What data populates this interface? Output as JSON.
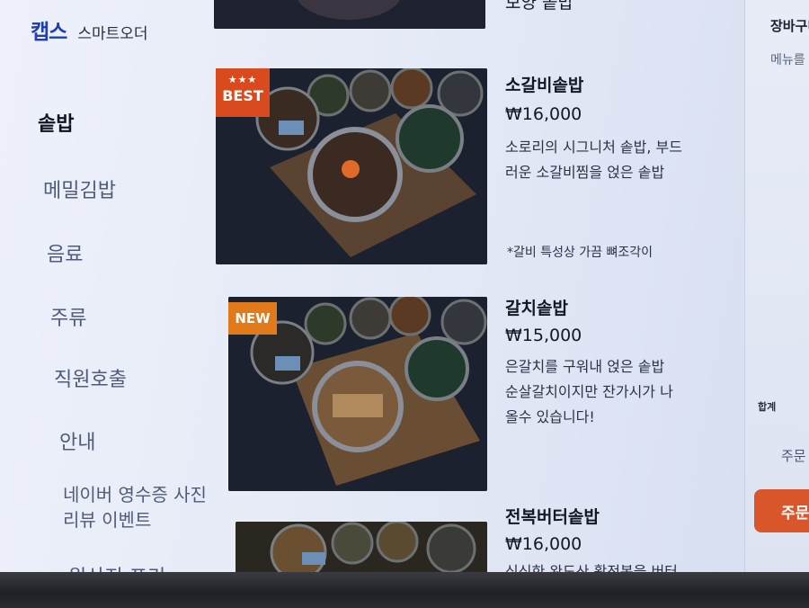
{
  "brand": {
    "logo": "캡스",
    "subtitle": "스마트오더"
  },
  "categories": [
    {
      "label": "솥밥",
      "active": true
    },
    {
      "label": "메밀김밥"
    },
    {
      "label": "음료"
    },
    {
      "label": "주류"
    },
    {
      "label": "직원호출"
    },
    {
      "label": "안내"
    },
    {
      "label": "네이버 영수증 사진리뷰 이벤트"
    },
    {
      "label": "원산지 표기"
    }
  ],
  "menu": {
    "partial_top_name": "보양 솥밥",
    "items": [
      {
        "name": "소갈비솥밥",
        "price": "₩16,000",
        "desc_line1": "소로리의 시그니처 솥밥, 부드",
        "desc_line2": "러운 소갈비찜을 얹은 솥밥",
        "note": "*갈비 특성상 가끔 뼈조각이",
        "badge": {
          "type": "best",
          "stars": "★★★",
          "text": "BEST"
        }
      },
      {
        "name": "갈치솥밥",
        "price": "₩15,000",
        "desc_line1": "은갈치를 구워내 얹은 솥밥",
        "desc_line2": "순살갈치이지만 잔가시가 나",
        "desc_line3": "올수 있습니다!",
        "badge": {
          "type": "new",
          "text": "NEW"
        }
      },
      {
        "name": "전복버터솥밥",
        "price": "₩16,000",
        "desc_line1": "싱싱한 완도산 활전복을 버터"
      }
    ]
  },
  "cart": {
    "title": "장바구니",
    "subtitle": "메뉴를 담아주세요",
    "total_label": "합계",
    "order_label": "주문",
    "button_label": "주문하기"
  },
  "colors": {
    "brand": "#1f3fb0",
    "best_badge": "#d94a1f",
    "new_badge": "#e07a1a",
    "order_button": "#d9552a"
  }
}
